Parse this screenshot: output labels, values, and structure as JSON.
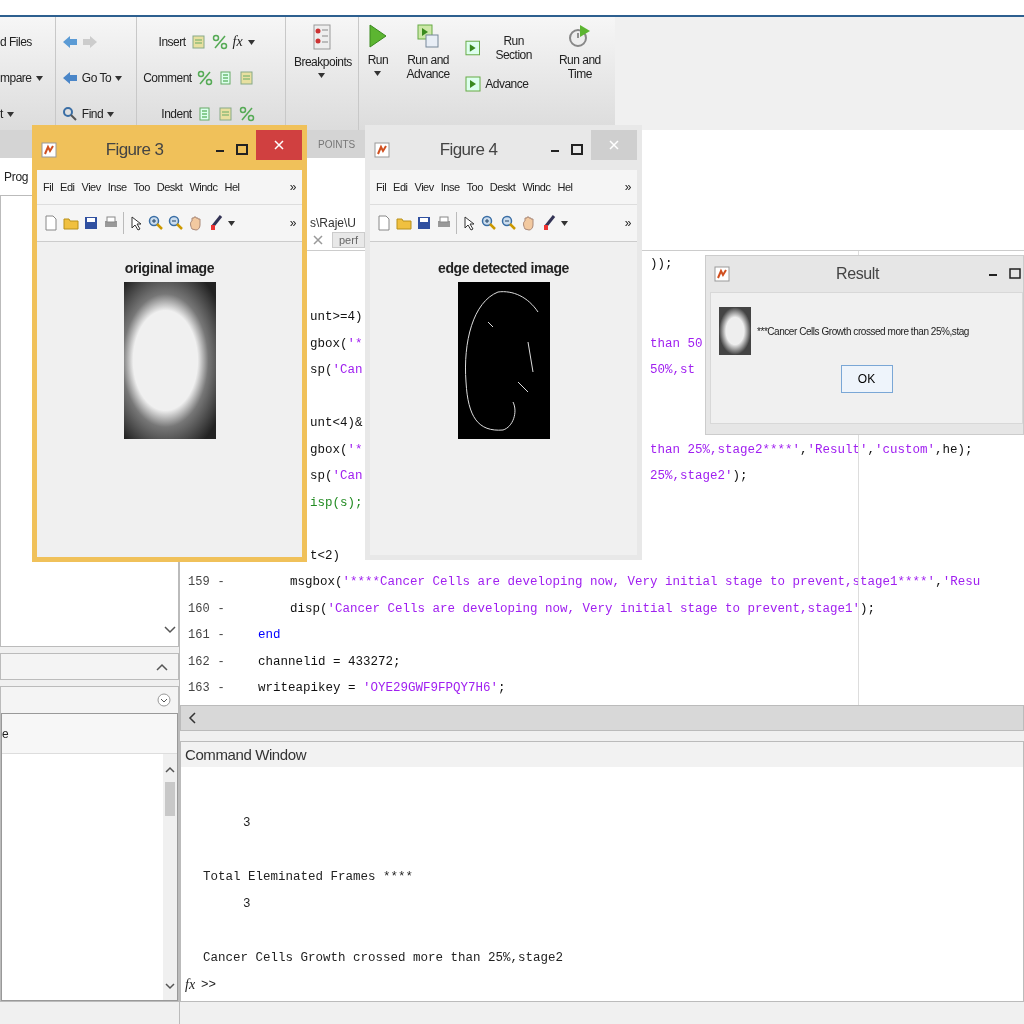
{
  "ribbon": {
    "file": [
      {
        "label": "d Files",
        "dropdown": false
      },
      {
        "label": "mpare",
        "dropdown": true
      },
      {
        "label": "t",
        "dropdown": true
      }
    ],
    "navigate": [
      {
        "kind": "arrows"
      },
      {
        "kind": "goto",
        "label": "Go To",
        "dropdown": true
      },
      {
        "kind": "find",
        "label": "Find",
        "dropdown": true
      }
    ],
    "edit": [
      {
        "label": "Insert"
      },
      {
        "label": "Comment"
      },
      {
        "label": "Indent"
      }
    ],
    "function_label": "fx",
    "breakpoints": {
      "label": "Breakpoints",
      "dropdown": true
    },
    "run": [
      {
        "kind": "run",
        "label": "Run",
        "dropdown": true
      },
      {
        "kind": "run_advance",
        "label": "Run and Advance",
        "dropdown": false
      },
      {
        "kind": "section_pair",
        "items": [
          "Run Section",
          "Advance"
        ]
      },
      {
        "kind": "run_time",
        "label": "Run and Time",
        "dropdown": false
      }
    ],
    "section_label": "POINTS"
  },
  "current_folder": {
    "address": "Prog"
  },
  "workspace": {
    "column_1": "e"
  },
  "editor": {
    "path": "s\\Raje\\U",
    "tabs": [
      {
        "label": "perf",
        "selected": false
      }
    ],
    "lines": [
      {
        "kind": "fragment",
        "right": [
          {
            "kind": "plain",
            "text": "));"
          }
        ]
      },
      {
        "kind": "blank"
      },
      {
        "kind": "fragment",
        "left": [
          {
            "kind": "plain",
            "text": "unt>=4)"
          }
        ]
      },
      {
        "kind": "fragment",
        "left": [
          {
            "kind": "plain",
            "text": "gbox("
          },
          {
            "kind": "string",
            "text": "'*"
          }
        ],
        "right": [
          {
            "kind": "string",
            "text": "than 50"
          }
        ]
      },
      {
        "kind": "fragment",
        "left": [
          {
            "kind": "plain",
            "text": "sp("
          },
          {
            "kind": "string",
            "text": "'Can"
          }
        ],
        "right": [
          {
            "kind": "string",
            "text": "50%,st"
          }
        ]
      },
      {
        "kind": "blank"
      },
      {
        "kind": "fragment",
        "left": [
          {
            "kind": "plain",
            "text": "unt<4)&"
          }
        ]
      },
      {
        "kind": "fragment",
        "left": [
          {
            "kind": "plain",
            "text": "gbox("
          },
          {
            "kind": "string",
            "text": "'*"
          }
        ],
        "right": [
          {
            "kind": "string",
            "text": "than 25%,stage2****'"
          },
          {
            "kind": "plain",
            "text": ","
          },
          {
            "kind": "string",
            "text": "'Result'"
          },
          {
            "kind": "plain",
            "text": ","
          },
          {
            "kind": "string",
            "text": "'custom'"
          },
          {
            "kind": "plain",
            "text": ",he);"
          }
        ]
      },
      {
        "kind": "fragment",
        "left": [
          {
            "kind": "plain",
            "text": "sp("
          },
          {
            "kind": "string",
            "text": "'Can"
          }
        ],
        "right": [
          {
            "kind": "string",
            "text": "25%,stage2'"
          },
          {
            "kind": "plain",
            "text": ");"
          }
        ]
      },
      {
        "kind": "fragment",
        "left": [
          {
            "kind": "comment",
            "text": "isp(s);"
          }
        ]
      },
      {
        "kind": "blank"
      },
      {
        "kind": "fragment",
        "left": [
          {
            "kind": "plain",
            "text": "t<2)"
          }
        ]
      },
      {
        "kind": "full",
        "number": "159",
        "dash": "-",
        "indented": true,
        "segments": [
          {
            "kind": "plain",
            "text": "msgbox("
          },
          {
            "kind": "string",
            "text": "'****Cancer Cells are developing now, Very initial stage to prevent,stage1****'"
          },
          {
            "kind": "plain",
            "text": ","
          },
          {
            "kind": "string",
            "text": "'Resu"
          }
        ]
      },
      {
        "kind": "full",
        "number": "160",
        "dash": "-",
        "indented": true,
        "segments": [
          {
            "kind": "plain",
            "text": "disp("
          },
          {
            "kind": "string",
            "text": "'Cancer Cells are developing now, Very initial stage to prevent,stage1'"
          },
          {
            "kind": "plain",
            "text": ");"
          }
        ]
      },
      {
        "kind": "full",
        "number": "161",
        "dash": "-",
        "indented": false,
        "segments": [
          {
            "kind": "keyword",
            "text": "end"
          }
        ]
      },
      {
        "kind": "full",
        "number": "162",
        "dash": "-",
        "indented": false,
        "segments": [
          {
            "kind": "plain",
            "text": "channelid = 433272;"
          }
        ]
      },
      {
        "kind": "full",
        "number": "163",
        "dash": "-",
        "indented": false,
        "segments": [
          {
            "kind": "plain",
            "text": "writeapikey = "
          },
          {
            "kind": "string",
            "text": "'OYE29GWF9FPQY7H6'"
          },
          {
            "kind": "plain",
            "text": ";"
          }
        ]
      }
    ]
  },
  "command_window": {
    "title": "Command Window",
    "lines": [
      {
        "kind": "value",
        "text": "3"
      },
      {
        "kind": "blank"
      },
      {
        "kind": "text",
        "text": "Total Eleminated Frames ****"
      },
      {
        "kind": "value",
        "text": "3"
      },
      {
        "kind": "blank"
      },
      {
        "kind": "text",
        "text": "Cancer Cells Growth crossed more than 25%,stage2"
      }
    ],
    "prompt_icon": "fx",
    "prompt": ">>"
  },
  "figures": [
    {
      "kind": "photo",
      "title": "Figure 3",
      "active": true,
      "menu": [
        "Fil",
        "Edi",
        "Viev",
        "Inse",
        "Too",
        "Deskt",
        "Windc",
        "Hel"
      ],
      "menu_more": "»",
      "toolbar_more": "»",
      "axes_title": "original image"
    },
    {
      "kind": "edges",
      "title": "Figure 4",
      "active": false,
      "menu": [
        "Fil",
        "Edi",
        "Viev",
        "Inse",
        "Too",
        "Deskt",
        "Windc",
        "Hel"
      ],
      "menu_more": "»",
      "toolbar_more": "»",
      "axes_title": "edge detected image"
    }
  ],
  "dialog": {
    "title": "Result",
    "message": "***Cancer Cells Growth crossed more than 25%,stag",
    "button": "OK"
  }
}
